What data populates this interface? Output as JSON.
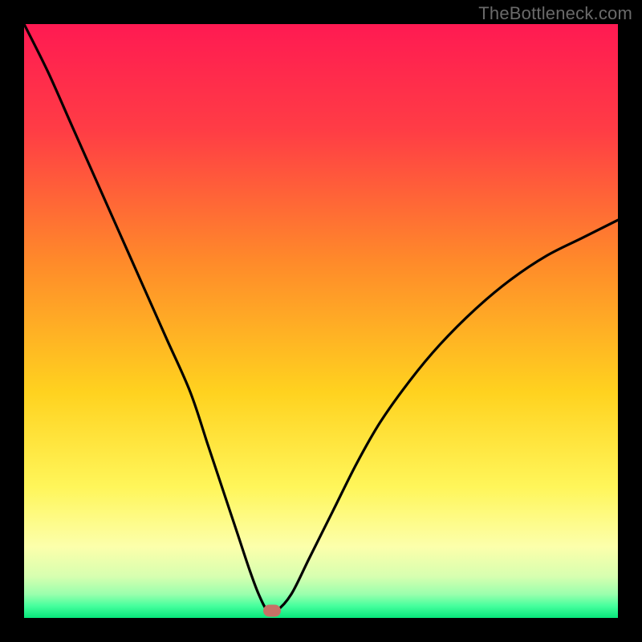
{
  "watermark": "TheBottleneck.com",
  "chart_data": {
    "type": "line",
    "title": "",
    "xlabel": "",
    "ylabel": "",
    "xlim": [
      0,
      100
    ],
    "ylim": [
      0,
      100
    ],
    "grid": false,
    "legend": false,
    "series": [
      {
        "name": "bottleneck-curve",
        "x": [
          0,
          4,
          8,
          12,
          16,
          20,
          24,
          28,
          31,
          34,
          36,
          38,
          39.5,
          41,
          42.5,
          45,
          48,
          52,
          56,
          60,
          65,
          70,
          76,
          82,
          88,
          94,
          100
        ],
        "y": [
          100,
          92,
          83,
          74,
          65,
          56,
          47,
          38,
          29,
          20,
          14,
          8,
          4,
          1.2,
          1.2,
          4,
          10,
          18,
          26,
          33,
          40,
          46,
          52,
          57,
          61,
          64,
          67
        ]
      }
    ],
    "marker": {
      "x": 41.8,
      "y": 1.2
    },
    "gradient_stops": [
      {
        "pct": 0,
        "color": "#ff1a52"
      },
      {
        "pct": 18,
        "color": "#ff3d45"
      },
      {
        "pct": 40,
        "color": "#ff8a2a"
      },
      {
        "pct": 62,
        "color": "#ffd21f"
      },
      {
        "pct": 78,
        "color": "#fff65a"
      },
      {
        "pct": 88,
        "color": "#fcffab"
      },
      {
        "pct": 93,
        "color": "#d7ffb0"
      },
      {
        "pct": 96,
        "color": "#9affad"
      },
      {
        "pct": 98,
        "color": "#45ff9d"
      },
      {
        "pct": 100,
        "color": "#08e67a"
      }
    ]
  }
}
